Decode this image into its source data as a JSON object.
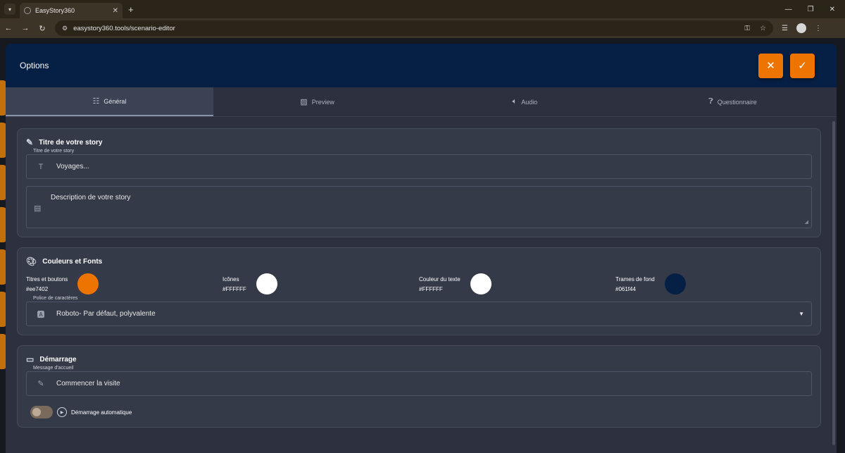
{
  "browser": {
    "tab_title": "EasyStory360",
    "url": "easystory360.tools/scenario-editor"
  },
  "modal": {
    "title": "Options",
    "close_icon": "close-icon",
    "confirm_icon": "check-icon"
  },
  "tabs": [
    {
      "label": "Général",
      "icon": "tune-icon",
      "active": true
    },
    {
      "label": "Preview",
      "icon": "image-icon",
      "active": false
    },
    {
      "label": "Audio",
      "icon": "volume-icon",
      "active": false
    },
    {
      "label": "Questionnaire",
      "icon": "quiz-icon",
      "active": false
    }
  ],
  "story": {
    "section_title": "Titre de votre story",
    "title_label": "Titre de votre story",
    "title_value": "Voyages...",
    "description_placeholder": "Description de votre story"
  },
  "colors": {
    "section_title": "Couleurs et Fonts",
    "items": [
      {
        "name": "Titres et boutons",
        "hex": "#ee7402"
      },
      {
        "name": "Icônes",
        "hex": "#FFFFFF"
      },
      {
        "name": "Couleur du texte",
        "hex": "#FFFFFF"
      },
      {
        "name": "Trames de fond",
        "hex": "#061f44"
      }
    ],
    "font_label": "Police de caractères",
    "font_value": "Roboto- Par défaut, polyvalente"
  },
  "start": {
    "section_title": "Démarrage",
    "welcome_label": "Message d'accueil",
    "welcome_value": "Commencer la visite",
    "autostart_label": "Démarrage automatique",
    "autostart_on": false
  },
  "theme": {
    "accent": "#ee7402",
    "header_bg": "#061f44",
    "modal_bg": "#2d313f"
  }
}
